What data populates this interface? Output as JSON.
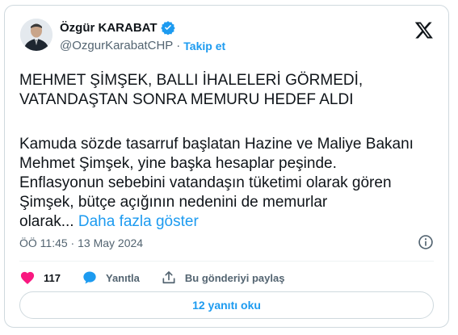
{
  "author": {
    "name": "Özgür KARABAT",
    "handle": "@OzgurKarabatCHP",
    "follow_label": "Takip et",
    "separator": "·"
  },
  "tweet": {
    "headline_line1": "MEHMET ŞİMŞEK, BALLI İHALELERİ GÖRMEDİ,",
    "headline_line2": "VATANDAŞTAN SONRA MEMURU HEDEF ALDI",
    "body_line1": "Kamuda sözde tasarruf başlatan Hazine ve Maliye Bakanı",
    "body_line2": "Mehmet Şimşek, yine başka hesaplar peşinde.",
    "body_line3": "Enflasyonun sebebini vatandaşın tüketimi olarak gören",
    "body_line4": "Şimşek, bütçe açığının nedenini de memurlar",
    "body_line5": "olarak...",
    "show_more": "Daha fazla göster",
    "timestamp": "ÖÖ 11:45 · 13 May 2024"
  },
  "actions": {
    "likes": "117",
    "reply_label": "Yanıtla",
    "share_label": "Bu gönderiyi paylaş"
  },
  "replies_button": "12 yanıtı oku",
  "colors": {
    "accent": "#1d9bf0",
    "like": "#f91880",
    "text": "#0f1419",
    "muted": "#536471"
  }
}
